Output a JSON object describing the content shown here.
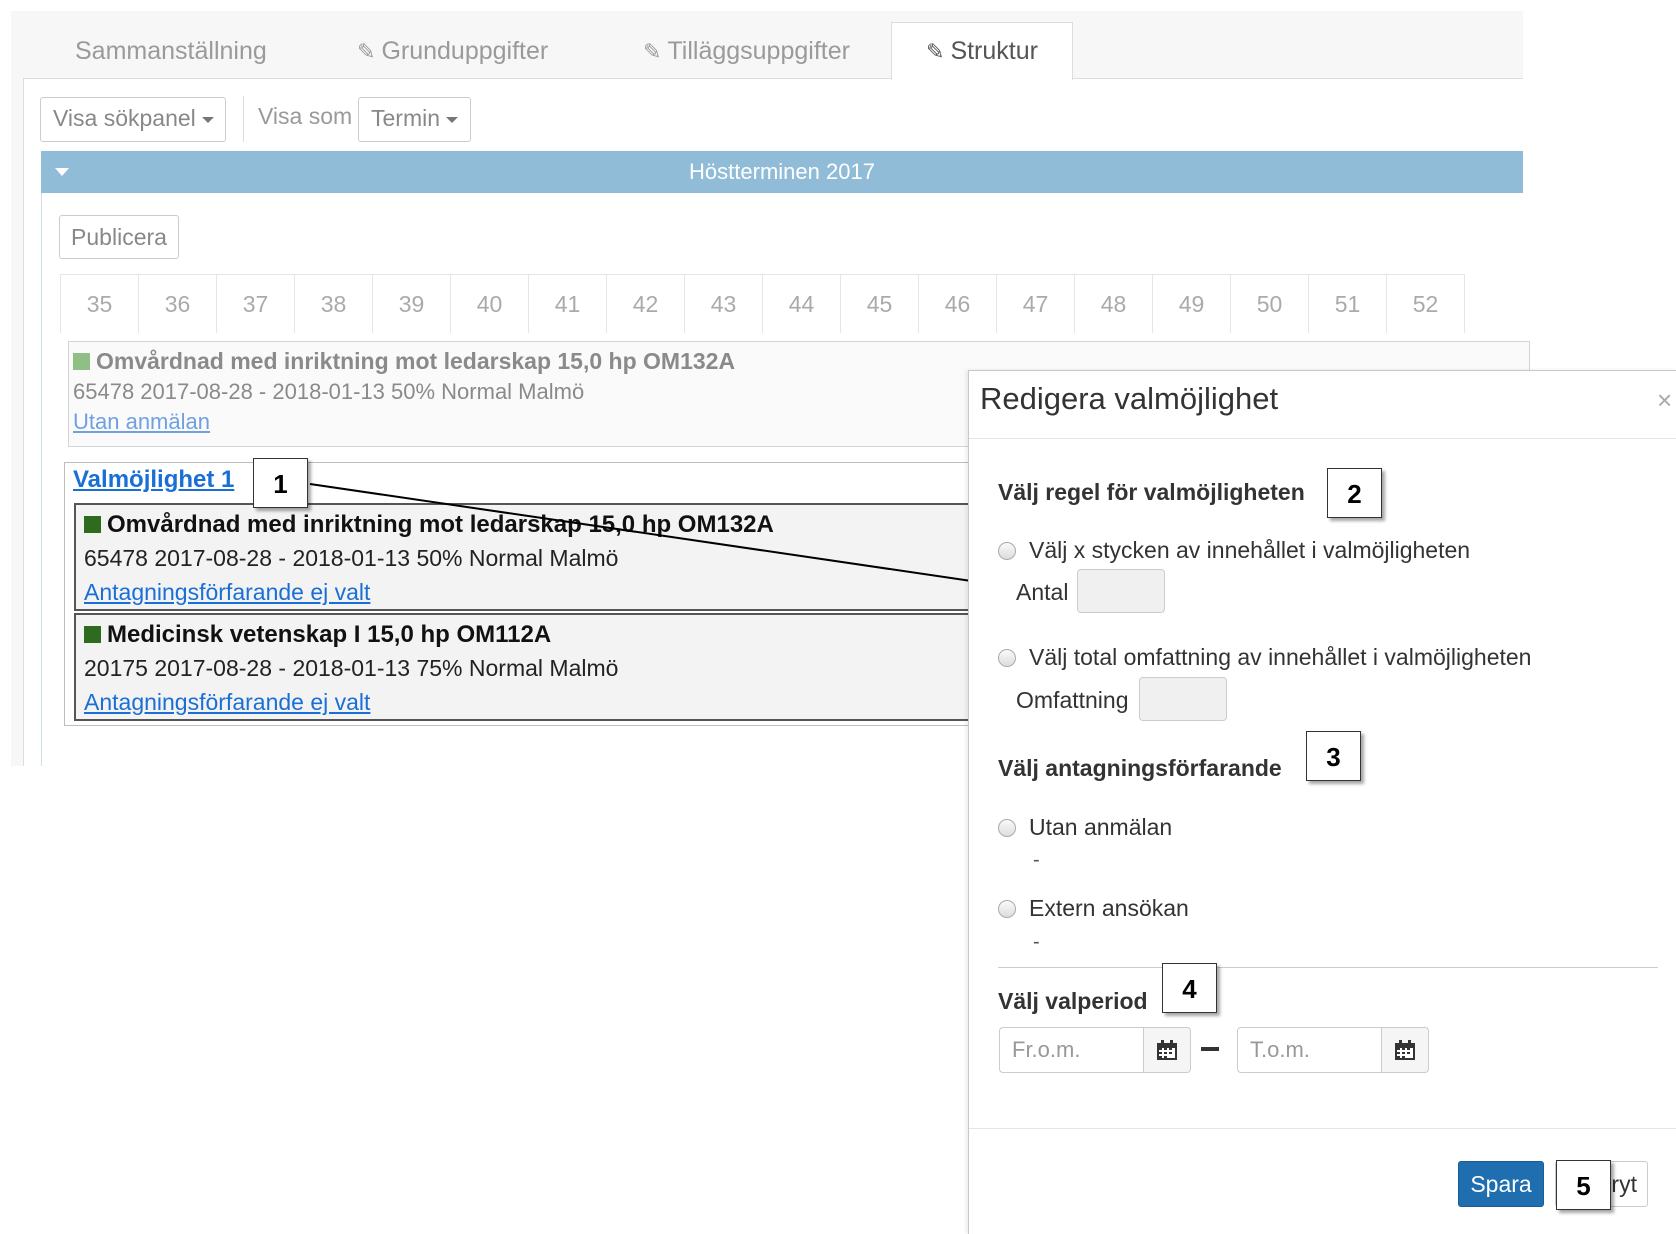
{
  "tabs": [
    {
      "label": "Sammanställning",
      "icon": ""
    },
    {
      "label": "Grunduppgifter",
      "icon": "pencil-icon"
    },
    {
      "label": "Tilläggsuppgifter",
      "icon": "pencil-icon"
    },
    {
      "label": "Struktur",
      "icon": "pencil-icon",
      "active": true
    }
  ],
  "toolbar": {
    "visa_sokpanel": "Visa sökpanel",
    "visa_som": "Visa som",
    "termin": "Termin"
  },
  "term": {
    "header": "Höstterminen 2017",
    "publicera": "Publicera",
    "weeks": [
      "35",
      "36",
      "37",
      "38",
      "39",
      "40",
      "41",
      "42",
      "43",
      "44",
      "45",
      "46",
      "47",
      "48",
      "49",
      "50",
      "51",
      "52"
    ]
  },
  "course_top": {
    "title": "Omvårdnad med inriktning mot ledarskap 15,0 hp OM132A",
    "info": "65478 2017-08-28 - 2018-01-13 50% Normal Malmö",
    "link": "Utan anmälan",
    "color": "#8fbf85"
  },
  "valmojlighet": {
    "link": "Valmöjlighet 1",
    "courses": [
      {
        "title": "Omvårdnad med inriktning mot ledarskap 15,0 hp OM132A",
        "info": "65478 2017-08-28 - 2018-01-13 50% Normal Malmö",
        "link": "Antagningsförfarande ej valt",
        "color": "#2e6b1f"
      },
      {
        "title": "Medicinsk vetenskap I 15,0 hp OM112A",
        "info": "20175 2017-08-28 - 2018-01-13 75% Normal Malmö",
        "link": "Antagningsförfarande ej valt",
        "color": "#2e6b1f"
      }
    ]
  },
  "modal": {
    "title": "Redigera valmöjlighet",
    "close": "×",
    "rule_heading": "Välj regel för valmöjligheten",
    "rule_option_count": "Välj x stycken av innehållet i valmöjligheten",
    "antal_label": "Antal",
    "rule_option_scope": "Välj total omfattning av innehållet i valmöjligheten",
    "omfattning_label": "Omfattning",
    "admission_heading": "Välj antagningsförfarande",
    "admission_option_1": "Utan anmälan",
    "admission_option_1_desc": "-",
    "admission_option_2": "Extern ansökan",
    "admission_option_2_desc": "-",
    "period_heading": "Välj valperiod",
    "from_placeholder": "Fr.o.m.",
    "to_placeholder": "T.o.m.",
    "save": "Spara",
    "cancel": "Avbryt"
  },
  "callouts": [
    "1",
    "2",
    "3",
    "4",
    "5"
  ],
  "colors": {
    "term_header": "#90bcd8",
    "link": "#1a6fd6",
    "primary_button": "#1f6fb0"
  }
}
